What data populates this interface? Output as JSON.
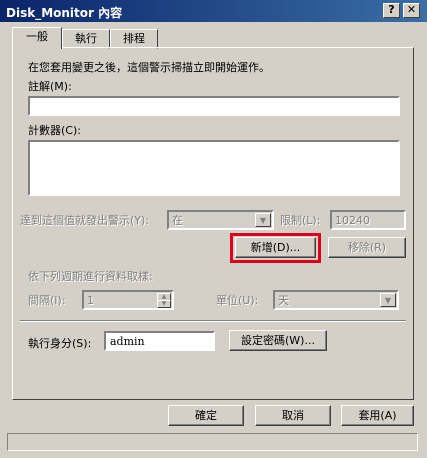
{
  "window": {
    "title": "Disk_Monitor 內容",
    "help_label": "?",
    "close_label": "✕"
  },
  "tabs": [
    {
      "label": "一般"
    },
    {
      "label": "執行"
    },
    {
      "label": "排程"
    }
  ],
  "general": {
    "intro": "在您套用變更之後，這個警示掃描立即開始運作。",
    "comment": {
      "label": "註解(M):",
      "value": ""
    },
    "counters": {
      "label": "計數器(C):"
    },
    "threshold": {
      "label": "達到這個值就發出警示(Y):",
      "condition": "在",
      "limit_label": "限制(L):",
      "limit_value": "10240"
    },
    "add_button": "新增(D)...",
    "remove_button": "移除(R)",
    "sample_label": "依下列週期進行資料取樣:",
    "interval": {
      "label": "間隔(I):",
      "value": "1"
    },
    "units": {
      "label": "單位(U):",
      "value": "天"
    },
    "run_as": {
      "label": "執行身分(S):",
      "value": "admin"
    },
    "set_password_button": "設定密碼(W)..."
  },
  "footer": {
    "ok": "確定",
    "cancel": "取消",
    "apply": "套用(A)"
  },
  "colors": {
    "titlebar_start": "#0a246a",
    "titlebar_end": "#3a6ea5",
    "highlight": "#e0001b",
    "face": "#d4d0c8"
  },
  "icons": {
    "close": "close-icon",
    "help": "help-icon",
    "dropdown": "chevron-down-icon",
    "spin_up": "chevron-up-icon",
    "spin_down": "chevron-down-icon"
  }
}
